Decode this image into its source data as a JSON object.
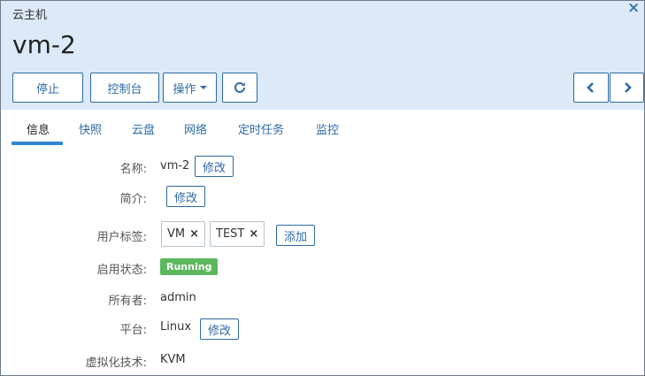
{
  "header": {
    "kicker": "云主机",
    "title": "vm-2",
    "close_icon": "×"
  },
  "toolbar": {
    "stop_label": "停止",
    "console_label": "控制台",
    "actions_label": "操作",
    "refresh_icon": "refresh-icon",
    "prev_icon": "chevron-left-icon",
    "next_icon": "chevron-right-icon"
  },
  "tabs": [
    {
      "label": "信息",
      "active": true
    },
    {
      "label": "快照"
    },
    {
      "label": "云盘"
    },
    {
      "label": "网络"
    },
    {
      "label": "定时任务"
    },
    {
      "label": "监控"
    }
  ],
  "details": {
    "name_label": "名称:",
    "name_value": "vm-2",
    "name_edit": "修改",
    "desc_label": "简介:",
    "desc_edit": "修改",
    "tags_label": "用户标签:",
    "tags": [
      "VM",
      "TEST"
    ],
    "tag_remove": "×",
    "tags_add": "添加",
    "state_label": "启用状态:",
    "state_value": "Running",
    "owner_label": "所有者:",
    "owner_value": "admin",
    "platform_label": "平台:",
    "platform_value": "Linux",
    "platform_edit": "修改",
    "virt_label": "虚拟化技术:",
    "virt_value": "KVM"
  },
  "colors": {
    "header_bg": "#dbe9f8",
    "accent": "#2d6aa3",
    "running": "#5cb85c"
  }
}
